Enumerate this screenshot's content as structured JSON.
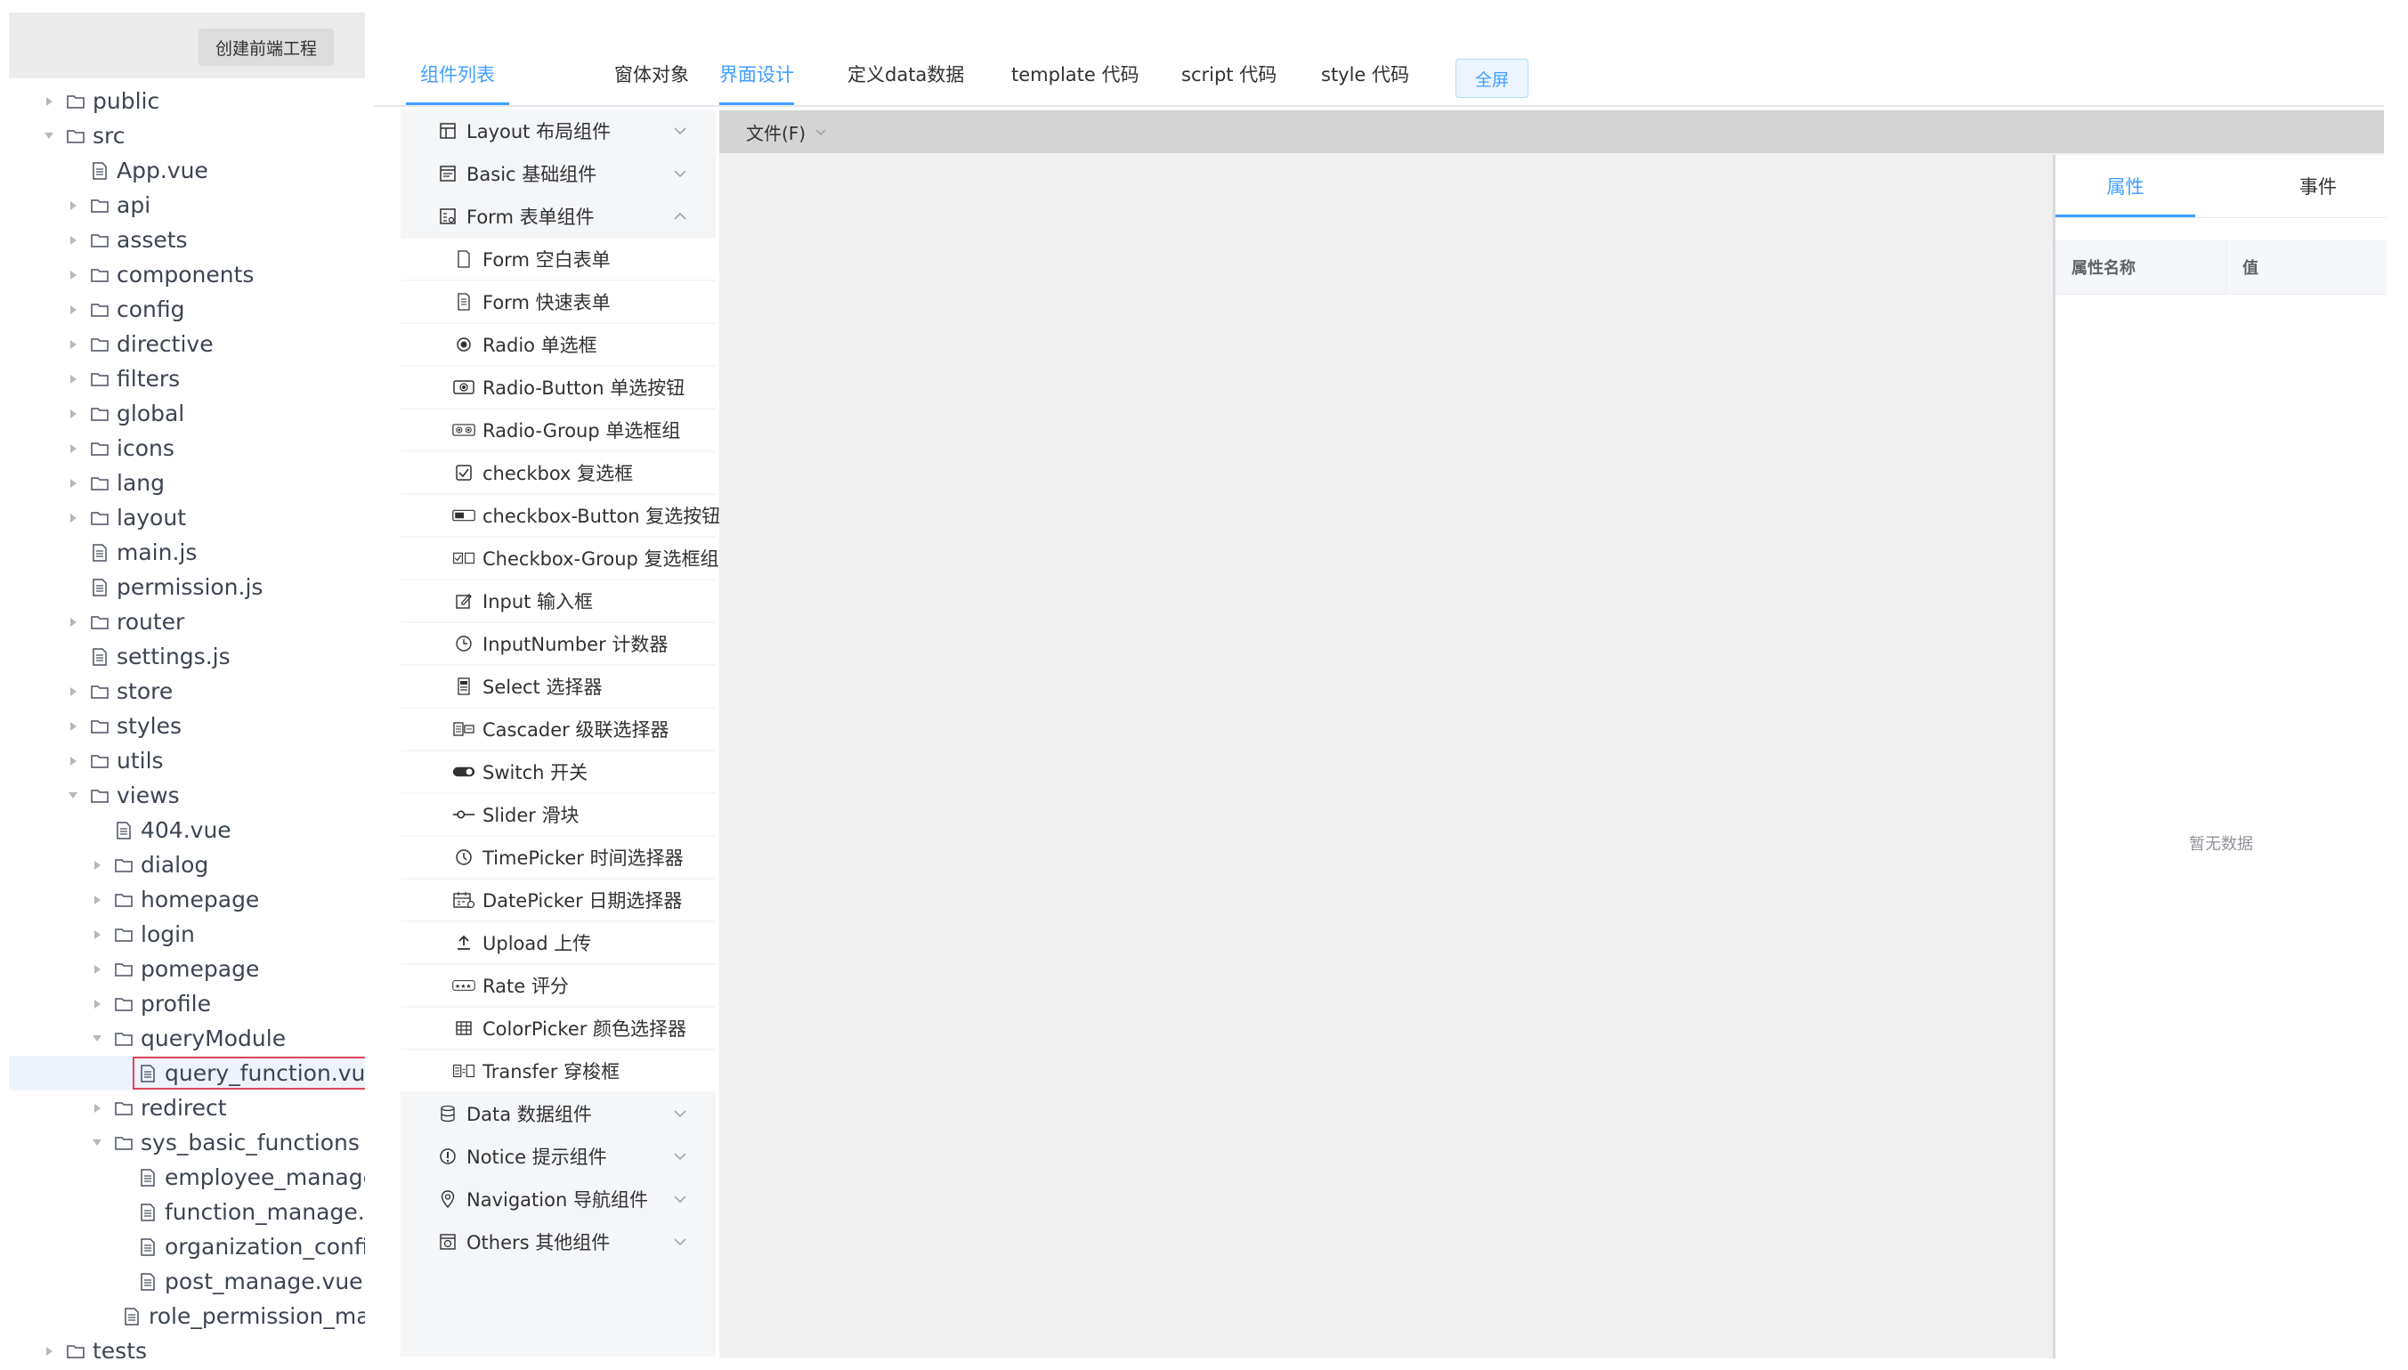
{
  "tree": {
    "create_button": "创建前端工程",
    "nodes": [
      {
        "label": "public",
        "type": "folder",
        "state": "collapsed",
        "depth": 0
      },
      {
        "label": "src",
        "type": "folder",
        "state": "expanded",
        "depth": 0
      },
      {
        "label": "App.vue",
        "type": "file",
        "state": "leaf",
        "depth": 1
      },
      {
        "label": "api",
        "type": "folder",
        "state": "collapsed",
        "depth": 1
      },
      {
        "label": "assets",
        "type": "folder",
        "state": "collapsed",
        "depth": 1
      },
      {
        "label": "components",
        "type": "folder",
        "state": "collapsed",
        "depth": 1
      },
      {
        "label": "config",
        "type": "folder",
        "state": "collapsed",
        "depth": 1
      },
      {
        "label": "directive",
        "type": "folder",
        "state": "collapsed",
        "depth": 1
      },
      {
        "label": "filters",
        "type": "folder",
        "state": "collapsed",
        "depth": 1
      },
      {
        "label": "global",
        "type": "folder",
        "state": "collapsed",
        "depth": 1
      },
      {
        "label": "icons",
        "type": "folder",
        "state": "collapsed",
        "depth": 1
      },
      {
        "label": "lang",
        "type": "folder",
        "state": "collapsed",
        "depth": 1
      },
      {
        "label": "layout",
        "type": "folder",
        "state": "collapsed",
        "depth": 1
      },
      {
        "label": "main.js",
        "type": "file",
        "state": "leaf",
        "depth": 1
      },
      {
        "label": "permission.js",
        "type": "file",
        "state": "leaf",
        "depth": 1
      },
      {
        "label": "router",
        "type": "folder",
        "state": "collapsed",
        "depth": 1
      },
      {
        "label": "settings.js",
        "type": "file",
        "state": "leaf",
        "depth": 1
      },
      {
        "label": "store",
        "type": "folder",
        "state": "collapsed",
        "depth": 1
      },
      {
        "label": "styles",
        "type": "folder",
        "state": "collapsed",
        "depth": 1
      },
      {
        "label": "utils",
        "type": "folder",
        "state": "collapsed",
        "depth": 1
      },
      {
        "label": "views",
        "type": "folder",
        "state": "expanded",
        "depth": 1
      },
      {
        "label": "404.vue",
        "type": "file",
        "state": "leaf",
        "depth": 2
      },
      {
        "label": "dialog",
        "type": "folder",
        "state": "collapsed",
        "depth": 2
      },
      {
        "label": "homepage",
        "type": "folder",
        "state": "collapsed",
        "depth": 2
      },
      {
        "label": "login",
        "type": "folder",
        "state": "collapsed",
        "depth": 2
      },
      {
        "label": "pomepage",
        "type": "folder",
        "state": "collapsed",
        "depth": 2
      },
      {
        "label": "profile",
        "type": "folder",
        "state": "collapsed",
        "depth": 2
      },
      {
        "label": "queryModule",
        "type": "folder",
        "state": "expanded",
        "depth": 2
      },
      {
        "label": "query_function.vue",
        "type": "file",
        "state": "leaf",
        "depth": 3,
        "selected": true
      },
      {
        "label": "redirect",
        "type": "folder",
        "state": "collapsed",
        "depth": 2
      },
      {
        "label": "sys_basic_functions",
        "type": "folder",
        "state": "expanded",
        "depth": 2
      },
      {
        "label": "employee_manage.vue",
        "type": "file",
        "state": "leaf",
        "depth": 3
      },
      {
        "label": "function_manage.vue",
        "type": "file",
        "state": "leaf",
        "depth": 3
      },
      {
        "label": "organization_config.vue",
        "type": "file",
        "state": "leaf",
        "depth": 3
      },
      {
        "label": "post_manage.vue",
        "type": "file",
        "state": "leaf",
        "depth": 3
      },
      {
        "label": "role_permission_manage.vue",
        "type": "file",
        "state": "leaf",
        "depth": 3
      },
      {
        "label": "tests",
        "type": "folder",
        "state": "collapsed",
        "depth": 0
      }
    ]
  },
  "tabs": {
    "component_list": "组件列表",
    "window_object": "窗体对象",
    "ui_design": "界面设计",
    "define_data": "定义data数据",
    "template_code": "template 代码",
    "script_code": "script 代码",
    "style_code": "style 代码",
    "fullscreen": "全屏"
  },
  "palette": {
    "rows": [
      {
        "label": "Layout 布局组件",
        "kind": "group",
        "icon": "layout-icon",
        "state": "collapsed"
      },
      {
        "label": "Basic 基础组件",
        "kind": "group",
        "icon": "basic-icon",
        "state": "collapsed"
      },
      {
        "label": "Form 表单组件",
        "kind": "group",
        "icon": "form-icon",
        "state": "expanded"
      },
      {
        "label": "Form 空白表单",
        "kind": "item",
        "icon": "blank-form-icon"
      },
      {
        "label": "Form 快速表单",
        "kind": "item",
        "icon": "quick-form-icon"
      },
      {
        "label": "Radio 单选框",
        "kind": "item",
        "icon": "radio-icon"
      },
      {
        "label": "Radio-Button 单选按钮",
        "kind": "item",
        "icon": "radio-button-icon"
      },
      {
        "label": "Radio-Group 单选框组",
        "kind": "item",
        "icon": "radio-group-icon"
      },
      {
        "label": "checkbox 复选框",
        "kind": "item",
        "icon": "checkbox-icon"
      },
      {
        "label": "checkbox-Button 复选按钮",
        "kind": "item",
        "icon": "checkbox-button-icon"
      },
      {
        "label": "Checkbox-Group 复选框组",
        "kind": "item",
        "icon": "checkbox-group-icon"
      },
      {
        "label": "Input 输入框",
        "kind": "item",
        "icon": "input-icon"
      },
      {
        "label": "InputNumber 计数器",
        "kind": "item",
        "icon": "input-number-icon"
      },
      {
        "label": "Select 选择器",
        "kind": "item",
        "icon": "select-icon"
      },
      {
        "label": "Cascader 级联选择器",
        "kind": "item",
        "icon": "cascader-icon"
      },
      {
        "label": "Switch 开关",
        "kind": "item",
        "icon": "switch-icon"
      },
      {
        "label": "Slider 滑块",
        "kind": "item",
        "icon": "slider-icon"
      },
      {
        "label": "TimePicker 时间选择器",
        "kind": "item",
        "icon": "time-picker-icon"
      },
      {
        "label": "DatePicker 日期选择器",
        "kind": "item",
        "icon": "date-picker-icon"
      },
      {
        "label": "Upload 上传",
        "kind": "item",
        "icon": "upload-icon"
      },
      {
        "label": "Rate 评分",
        "kind": "item",
        "icon": "rate-icon"
      },
      {
        "label": "ColorPicker 颜色选择器",
        "kind": "item",
        "icon": "color-picker-icon"
      },
      {
        "label": "Transfer 穿梭框",
        "kind": "item",
        "icon": "transfer-icon"
      },
      {
        "label": "Data 数据组件",
        "kind": "group",
        "icon": "data-icon",
        "state": "collapsed"
      },
      {
        "label": "Notice 提示组件",
        "kind": "group",
        "icon": "notice-icon",
        "state": "collapsed"
      },
      {
        "label": "Navigation 导航组件",
        "kind": "group",
        "icon": "navigation-icon",
        "state": "collapsed"
      },
      {
        "label": "Others 其他组件",
        "kind": "group",
        "icon": "others-icon",
        "state": "collapsed"
      }
    ]
  },
  "canvas": {
    "file_menu": "文件(F)"
  },
  "properties": {
    "tab_attributes": "属性",
    "tab_events": "事件",
    "col_name": "属性名称",
    "col_value": "值",
    "empty_text": "暂无数据"
  },
  "colors": {
    "accent": "#409eff",
    "selection_border": "#e0455d"
  }
}
